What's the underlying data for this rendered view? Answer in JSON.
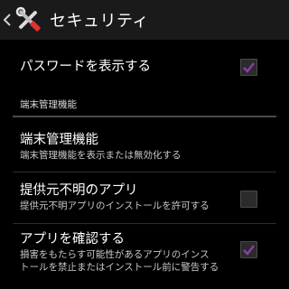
{
  "action_bar": {
    "title": "セキュリティ",
    "icon": "settings-tools-icon"
  },
  "prefs": {
    "show_password": {
      "title": "パスワードを表示する",
      "checked": true
    },
    "category": "端末管理機能",
    "device_admin": {
      "title": "端末管理機能",
      "summary": "端末管理機能を表示または無効化する"
    },
    "unknown_sources": {
      "title": "提供元不明のアプリ",
      "summary": "提供元不明アプリのインストールを許可する",
      "checked": false
    },
    "verify_apps": {
      "title": "アプリを確認する",
      "summary_line1": "損害をもたらす可能性があるアプリのインス",
      "summary_line2": "トールを禁止またはインストール前に警告する",
      "checked": true
    }
  },
  "colors": {
    "check_mark": "#8c3fa8",
    "action_bar_bg": "#1a1a1a"
  }
}
